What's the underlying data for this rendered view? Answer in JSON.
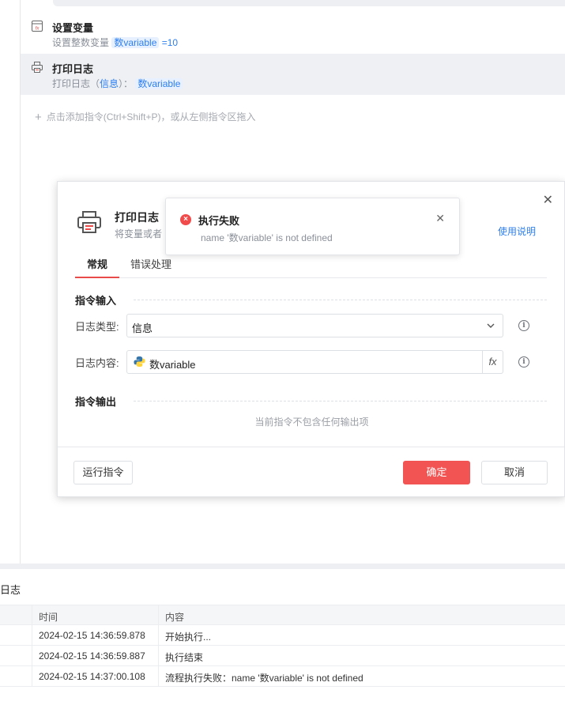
{
  "steps": [
    {
      "title": "设置变量",
      "desc_prefix": "设置整数变量 ",
      "var_chip": "数variable",
      "desc_suffix": " =10",
      "icon": "set-variable-icon"
    },
    {
      "title": "打印日志",
      "desc_prefix": "打印日志（",
      "log_type": "信息",
      "desc_mid": "）： ",
      "var_chip": "数variable",
      "icon": "printer-icon"
    }
  ],
  "add_hint": "点击添加指令(Ctrl+Shift+P)，或从左侧指令区拖入",
  "dialog": {
    "title": "打印日志",
    "subtitle": "将变量或者",
    "help_link": "使用说明",
    "tabs": [
      "常规",
      "错误处理"
    ],
    "input_section": "指令输入",
    "output_section": "指令输出",
    "log_type_label": "日志类型:",
    "log_type_value": "信息",
    "log_content_label": "日志内容:",
    "log_content_value": "数variable",
    "fx_label": "fx",
    "no_output": "当前指令不包含任何输出项",
    "run_button": "运行指令",
    "ok_button": "确定",
    "cancel_button": "取消"
  },
  "toast": {
    "title": "执行失败",
    "message": "name '数variable' is not defined"
  },
  "log": {
    "title": "日志",
    "headers": [
      "时间",
      "内容"
    ],
    "rows": [
      {
        "time": "2024-02-15 14:36:59.878",
        "content": "开始执行..."
      },
      {
        "time": "2024-02-15 14:36:59.887",
        "content": "执行结束"
      },
      {
        "time": "2024-02-15 14:37:00.108",
        "content": "流程执行失败：name '数variable' is not defined"
      }
    ]
  },
  "colors": {
    "accent": "#2d7ff0",
    "danger": "#f15453",
    "chip_bg": "#e6f0ff"
  }
}
